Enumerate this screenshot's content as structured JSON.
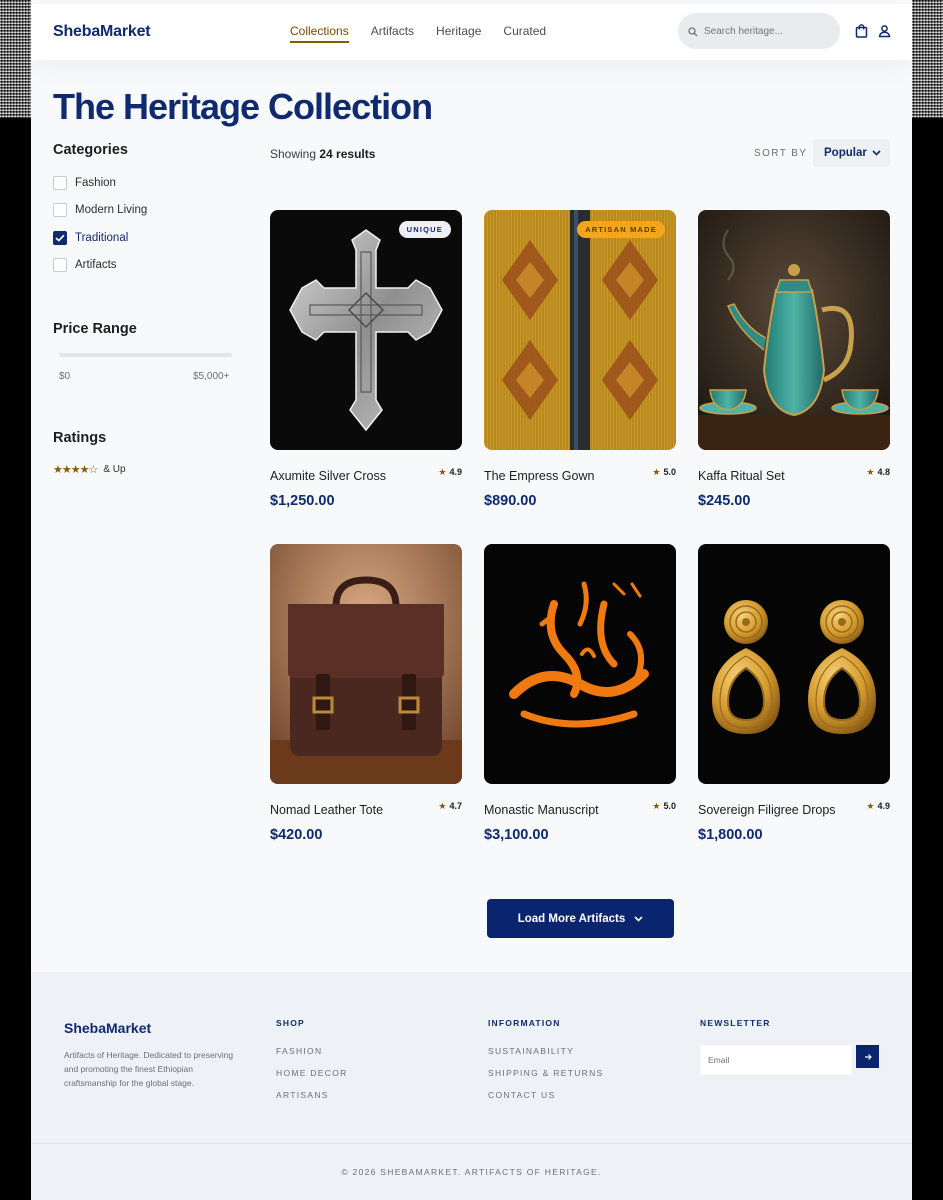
{
  "brand": {
    "name": "ShebaMarket",
    "primary_color": "#0f2a6e",
    "accent_color": "#8a5a00"
  },
  "header": {
    "nav": [
      "Collections",
      "Artifacts",
      "Heritage",
      "Curated"
    ],
    "active_nav": "Collections",
    "search_placeholder": "Search heritage...",
    "icons": [
      "search-icon",
      "shopping-bag-icon",
      "user-icon"
    ]
  },
  "page_title": "The Heritage Collection",
  "filters": {
    "categories_title": "Categories",
    "categories": [
      {
        "label": "Fashion",
        "checked": false
      },
      {
        "label": "Modern Living",
        "checked": false
      },
      {
        "label": "Traditional",
        "checked": true
      },
      {
        "label": "Artifacts",
        "checked": false
      }
    ],
    "price_title": "Price Range",
    "price_min": "$0",
    "price_max": "$5,000+",
    "ratings_title": "Ratings",
    "rating_stars": "★★★★☆",
    "rating_label": "& Up"
  },
  "results": {
    "showing_prefix": "Showing",
    "count_text": "24 results",
    "sort_label": "SORT BY",
    "sort_value": "Popular"
  },
  "products": [
    {
      "name": "Axumite Silver Cross",
      "rating": "4.9",
      "price": "$1,250.00",
      "badge": "UNIQUE"
    },
    {
      "name": "The Empress Gown",
      "rating": "5.0",
      "price": "$890.00",
      "badge": "ARTISAN MADE"
    },
    {
      "name": "Kaffa Ritual Set",
      "rating": "4.8",
      "price": "$245.00",
      "badge": ""
    },
    {
      "name": "Nomad Leather Tote",
      "rating": "4.7",
      "price": "$420.00",
      "badge": ""
    },
    {
      "name": "Monastic Manuscript",
      "rating": "5.0",
      "price": "$3,100.00",
      "badge": ""
    },
    {
      "name": "Sovereign Filigree Drops",
      "rating": "4.9",
      "price": "$1,800.00",
      "badge": ""
    }
  ],
  "load_more": "Load More Artifacts",
  "footer": {
    "brand": "ShebaMarket",
    "description": "Artifacts of Heritage. Dedicated to preserving and promoting the finest Ethiopian craftsmanship for the global stage.",
    "shop_title": "SHOP",
    "shop_links": [
      "FASHION",
      "HOME DECOR",
      "ARTISANS"
    ],
    "info_title": "INFORMATION",
    "info_links": [
      "SUSTAINABILITY",
      "SHIPPING & RETURNS",
      "CONTACT US"
    ],
    "newsletter_title": "NEWSLETTER",
    "email_placeholder": "Email",
    "copyright": "© 2026 SHEBAMARKET. ARTIFACTS OF HERITAGE."
  }
}
